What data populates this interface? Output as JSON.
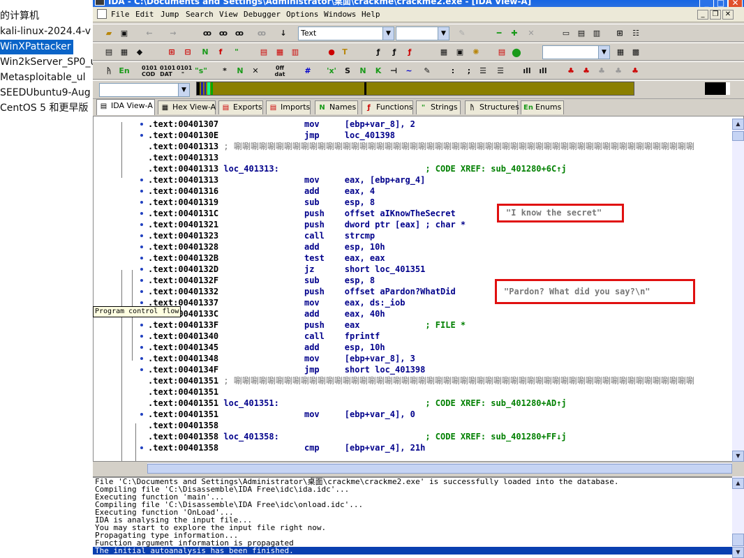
{
  "vm_list": {
    "items": [
      {
        "label": "的计算机"
      },
      {
        "label": "kali-linux-2024.4-v"
      },
      {
        "label": "WinXPattacker",
        "selected": true
      },
      {
        "label": "Win2kServer_SP0_ul"
      },
      {
        "label": "Metasploitable_ul"
      },
      {
        "label": "SEEDUbuntu9-Aug"
      },
      {
        "label": "CentOS 5 和更早版"
      }
    ]
  },
  "window": {
    "title": "IDA - C:\\Documents and Settings\\Administrator\\桌面\\crackme\\crackme2.exe - [IDA View-A]",
    "minimize": "_",
    "maximize": "□",
    "close": "✕"
  },
  "menu": [
    "File",
    "Edit",
    "Jump",
    "Search",
    "View",
    "Debugger",
    "Options",
    "Windows",
    "Help"
  ],
  "toolbar": {
    "search_mode_value": "Text",
    "search_value_2": "",
    "segment_combo": "",
    "address_combo": ""
  },
  "tabs": [
    {
      "label": "IDA View-A",
      "icon": "idaview-icon",
      "active": true
    },
    {
      "label": "Hex View-A",
      "icon": "hex-icon"
    },
    {
      "label": "Exports",
      "icon": "exports-icon"
    },
    {
      "label": "Imports",
      "icon": "imports-icon"
    },
    {
      "label": "Names",
      "icon": "N"
    },
    {
      "label": "Functions",
      "icon": "functions-icon"
    },
    {
      "label": "Strings",
      "icon": "strings-icon"
    },
    {
      "label": "Structures",
      "icon": "structures-icon"
    },
    {
      "label": "Enums",
      "icon": "En"
    }
  ],
  "disasm": [
    {
      "addr": ".text:00401307",
      "label": "",
      "mn": "mov",
      "op": "[ebp+var_8], 2",
      "cm": ""
    },
    {
      "addr": ".text:0040130E",
      "label": "",
      "mn": "jmp",
      "op": "loc_401398",
      "cm": ""
    },
    {
      "addr": ".text:00401313",
      "label": "",
      "mn": "",
      "op": "",
      "cm": "",
      "junk": "; 唰唰唰唰唰唰唰唰唰唰唰唰唰唰唰唰唰唰唰唰唰唰唰唰唰唰唰唰唰唰唰唰唰唰唰唰唰唰唰唰唰唰唰唰唰唰唰唰唰唰唰唰唰唰唰"
    },
    {
      "addr": ".text:00401313",
      "label": "",
      "mn": "",
      "op": "",
      "cm": ""
    },
    {
      "addr": ".text:00401313",
      "label": "loc_401313:",
      "mn": "",
      "op": "",
      "cm": "; CODE XREF: sub_401280+6C↑j"
    },
    {
      "addr": ".text:00401313",
      "label": "",
      "mn": "mov",
      "op": "eax, [ebp+arg_4]",
      "cm": ""
    },
    {
      "addr": ".text:00401316",
      "label": "",
      "mn": "add",
      "op": "eax, 4",
      "cm": ""
    },
    {
      "addr": ".text:00401319",
      "label": "",
      "mn": "sub",
      "op": "esp, 8",
      "cm": ""
    },
    {
      "addr": ".text:0040131C",
      "label": "",
      "mn": "push",
      "op": "offset aIKnowTheSecret",
      "cm": ""
    },
    {
      "addr": ".text:00401321",
      "label": "",
      "mn": "push",
      "op": "dword ptr [eax] ; char *",
      "cm": ""
    },
    {
      "addr": ".text:00401323",
      "label": "",
      "mn": "call",
      "op": "strcmp",
      "cm": ""
    },
    {
      "addr": ".text:00401328",
      "label": "",
      "mn": "add",
      "op": "esp, 10h",
      "cm": ""
    },
    {
      "addr": ".text:0040132B",
      "label": "",
      "mn": "test",
      "op": "eax, eax",
      "cm": ""
    },
    {
      "addr": ".text:0040132D",
      "label": "",
      "mn": "jz",
      "op": "short loc_401351",
      "cm": ""
    },
    {
      "addr": ".text:0040132F",
      "label": "",
      "mn": "sub",
      "op": "esp, 8",
      "cm": ""
    },
    {
      "addr": ".text:00401332",
      "label": "",
      "mn": "push",
      "op": "offset aPardon?WhatDid",
      "cm": ""
    },
    {
      "addr": ".text:00401337",
      "label": "",
      "mn": "mov",
      "op": "eax, ds:_iob",
      "cm": ""
    },
    {
      "addr": ".text:0040133C",
      "label": "",
      "mn": "add",
      "op": "eax, 40h",
      "cm": ""
    },
    {
      "addr": ".text:0040133F",
      "label": "",
      "mn": "push",
      "op": "eax",
      "cm": "; FILE *"
    },
    {
      "addr": ".text:00401340",
      "label": "",
      "mn": "call",
      "op": "fprintf",
      "cm": ""
    },
    {
      "addr": ".text:00401345",
      "label": "",
      "mn": "add",
      "op": "esp, 10h",
      "cm": ""
    },
    {
      "addr": ".text:00401348",
      "label": "",
      "mn": "mov",
      "op": "[ebp+var_8], 3",
      "cm": ""
    },
    {
      "addr": ".text:0040134F",
      "label": "",
      "mn": "jmp",
      "op": "short loc_401398",
      "cm": ""
    },
    {
      "addr": ".text:00401351",
      "label": "",
      "mn": "",
      "op": "",
      "cm": "",
      "junk": "; 唰唰唰唰唰唰唰唰唰唰唰唰唰唰唰唰唰唰唰唰唰唰唰唰唰唰唰唰唰唰唰唰唰唰唰唰唰唰唰唰唰唰唰唰唰唰唰唰唰唰唰唰唰唰唰"
    },
    {
      "addr": ".text:00401351",
      "label": "",
      "mn": "",
      "op": "",
      "cm": ""
    },
    {
      "addr": ".text:00401351",
      "label": "loc_401351:",
      "mn": "",
      "op": "",
      "cm": "; CODE XREF: sub_401280+AD↑j"
    },
    {
      "addr": ".text:00401351",
      "label": "",
      "mn": "mov",
      "op": "[ebp+var_4], 0",
      "cm": ""
    },
    {
      "addr": ".text:00401358",
      "label": "",
      "mn": "",
      "op": "",
      "cm": ""
    },
    {
      "addr": ".text:00401358",
      "label": "loc_401358:",
      "mn": "",
      "op": "",
      "cm": "; CODE XREF: sub_401280+FF↓j"
    },
    {
      "addr": ".text:00401358",
      "label": "",
      "mn": "cmp",
      "op": "[ebp+var_4], 21h",
      "cm": ""
    }
  ],
  "annotations": {
    "secret_string": "\"I know the secret\"",
    "pardon_string": "\"Pardon? What did you say?\\n\""
  },
  "tooltip": "Program control flow",
  "output_lines": [
    "File 'C:\\Documents and Settings\\Administrator\\桌面\\crackme\\crackme2.exe' is successfully loaded into the database.",
    "Compiling file 'C:\\Disassemble\\IDA Free\\idc\\ida.idc'...",
    "Executing function 'main'...",
    "Compiling file 'C:\\Disassemble\\IDA Free\\idc\\onload.idc'...",
    "Executing function 'OnLoad'...",
    "IDA is analysing the input file...",
    "You may start to explore the input file right now.",
    "Propagating type information...",
    "Function argument information is propagated",
    "The initial autoanalysis has been finished."
  ]
}
